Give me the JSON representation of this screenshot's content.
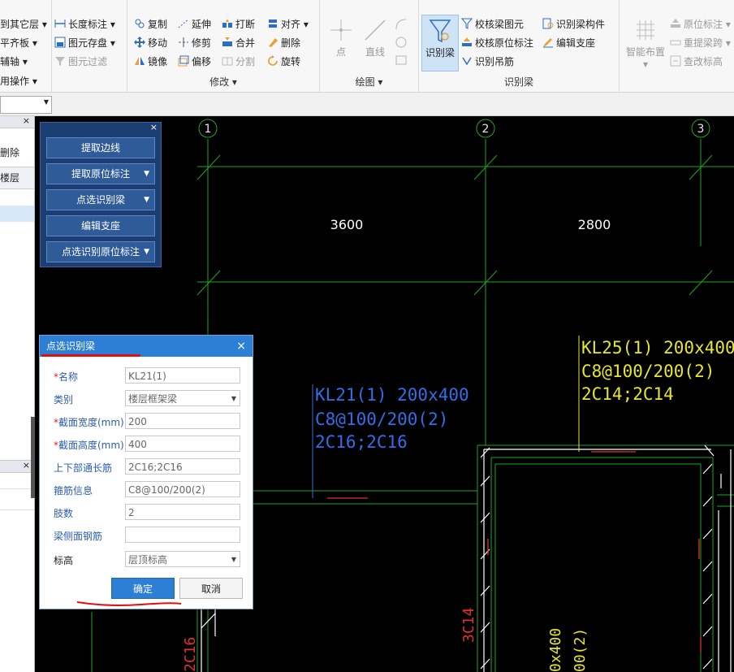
{
  "ribbon": {
    "group1": {
      "items": [
        "到其它层 ▾",
        "平齐板 ▾",
        "辅轴 ▾",
        "用操作 ▾"
      ]
    },
    "group2": {
      "items": [
        "长度标注 ▾",
        "图元存盘 ▾",
        "图元过滤"
      ]
    },
    "modify": {
      "label": "修改 ▾",
      "col1": [
        "复制",
        "移动",
        "镜像"
      ],
      "col2": [
        "延伸",
        "修剪",
        "偏移"
      ],
      "col3": [
        "打断",
        "合并",
        "分割"
      ],
      "col4": [
        "对齐 ▾",
        "删除",
        "旋转"
      ]
    },
    "draw": {
      "label": "绘图 ▾",
      "point": "点",
      "line": "直线"
    },
    "recognize": {
      "label": "识别梁",
      "big_button": "识别梁",
      "items": [
        "校核梁图元",
        "校核原位标注",
        "识别吊筋",
        "识别梁构件",
        "编辑支座"
      ]
    },
    "smart": {
      "big_button": "智能布置 ▾",
      "items": [
        "原位标注 ▾",
        "重提梁跨 ▾",
        "查改标高"
      ]
    }
  },
  "left_panel": {
    "close": "×",
    "item_delete": "删除",
    "item_floor": "楼层",
    "close2": "×"
  },
  "float_panel": {
    "close": "×",
    "buttons": [
      {
        "label": "提取边线",
        "dropdown": ""
      },
      {
        "label": "提取原位标注",
        "dropdown": "▼"
      },
      {
        "label": "点选识别梁",
        "dropdown": "▼"
      },
      {
        "label": "编辑支座",
        "dropdown": ""
      },
      {
        "label": "点选识别原位标注",
        "dropdown": "▼"
      }
    ]
  },
  "cad": {
    "axes": [
      "1",
      "2",
      "3"
    ],
    "dims": [
      "3600",
      "2800"
    ],
    "kl21": [
      "KL21(1) 200x400",
      "C8@100/200(2)",
      "2C16;2C16"
    ],
    "kl25": [
      "KL25(1) 200x400",
      "C8@100/200(2)",
      "2C14;2C14"
    ],
    "vtexts": [
      "2C16",
      "3C14",
      "0x400",
      "00(2)"
    ]
  },
  "dialog": {
    "title": "点选识别梁",
    "close": "×",
    "fields": [
      {
        "label": "名称",
        "required": "*",
        "value": "KL21(1)",
        "dropdown": ""
      },
      {
        "label": "类别",
        "required": "",
        "value": "楼层框架梁",
        "dropdown": "▼"
      },
      {
        "label": "截面宽度(mm)",
        "required": "*",
        "value": "200",
        "dropdown": ""
      },
      {
        "label": "截面高度(mm)",
        "required": "*",
        "value": "400",
        "dropdown": ""
      },
      {
        "label": "上下部通长筋",
        "required": "",
        "value": "2C16;2C16",
        "dropdown": ""
      },
      {
        "label": "箍筋信息",
        "required": "",
        "value": "C8@100/200(2)",
        "dropdown": ""
      },
      {
        "label": "肢数",
        "required": "",
        "value": "2",
        "dropdown": ""
      },
      {
        "label": "梁侧面钢筋",
        "required": "",
        "value": "",
        "dropdown": ""
      },
      {
        "label": "标高",
        "required": "",
        "value": "层顶标高",
        "dropdown": "▼"
      }
    ],
    "ok": "确定",
    "cancel": "取消"
  },
  "colors": {
    "ribbon_bg": "#f7f7f7",
    "dialog_title": "#2d7fd6",
    "float_panel": "#1b3f73",
    "cad_blue_text": "#2f6fe8",
    "cad_yellow_text": "#e6e62a",
    "cad_red_text": "#e03030",
    "cad_grid": "#1fa51f",
    "annotation_red": "#e01010"
  }
}
